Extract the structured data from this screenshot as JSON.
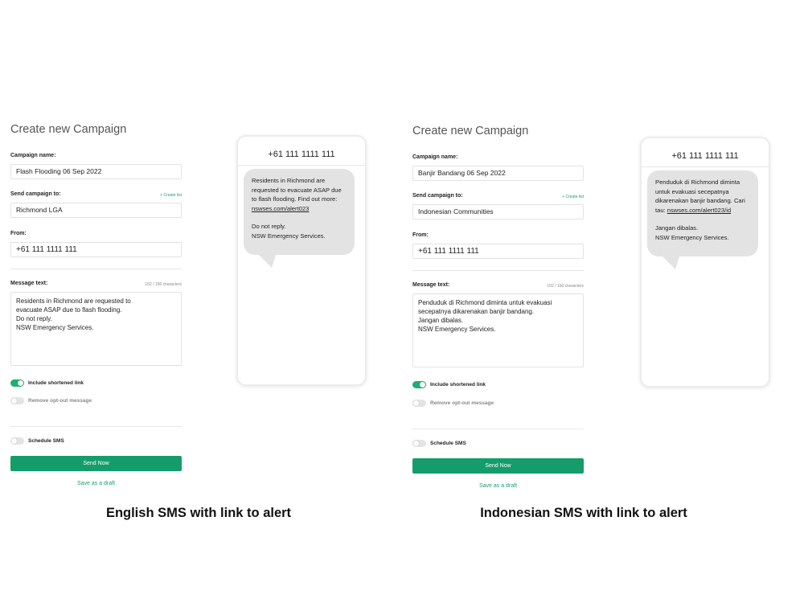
{
  "panels": [
    {
      "form": {
        "title": "Create new Campaign",
        "campaign_name_label": "Campaign name:",
        "campaign_name_value": "Flash Flooding 06 Sep 2022",
        "send_to_label": "Send campaign to:",
        "create_list_link": "+ Create list",
        "send_to_value": "Richmond LGA",
        "from_label": "From:",
        "from_value": "+61 111 1111 111",
        "message_label": "Message text:",
        "char_count": "102 / 160 characters",
        "message_value": "Residents in  Richmond are requested to\nevacuate ASAP due to flash flooding.\nDo not reply.\nNSW Emergency Services.",
        "include_link_label": "Include shortened link",
        "include_link_on": true,
        "opt_out_label": "Remove opt-out message",
        "opt_out_on": false,
        "schedule_label": "Schedule SMS",
        "schedule_on": false,
        "send_button": "Send Now",
        "draft_link": "Save as a draft"
      },
      "phone": {
        "number": "+61 111 1111 111",
        "line1": "Residents in  Richmond are requested to evacuate ASAP due to flash flooding. Find out more: ",
        "link": "nswses.com/alert023",
        "line2": "Do not reply.",
        "line3": "NSW Emergency Services."
      },
      "caption": "English SMS with link to alert"
    },
    {
      "form": {
        "title": "Create new Campaign",
        "campaign_name_label": "Campaign name:",
        "campaign_name_value": "Banjir Bandang 06 Sep 2022",
        "send_to_label": "Send campaign to:",
        "create_list_link": "+ Create list",
        "send_to_value": "Indonesian Communities",
        "from_label": "From:",
        "from_value": "+61 111 1111 111",
        "message_label": "Message text:",
        "char_count": "102 / 160 characters",
        "message_value": "Penduduk di Richmond diminta untuk evakuasi\nsecepatnya dikarenakan banjir bandang.\nJangan dibalas.\nNSW Emergency Services.",
        "include_link_label": "Include shortened link",
        "include_link_on": true,
        "opt_out_label": "Remove opt-out message",
        "opt_out_on": false,
        "schedule_label": "Schedule SMS",
        "schedule_on": false,
        "send_button": "Send Now",
        "draft_link": "Save as a draft"
      },
      "phone": {
        "number": "+61 111 1111 111",
        "line1": "Penduduk di Richmond diminta untuk evakuasi secepatnya dikarenakan banjir bandang. Cari tau: ",
        "link": "nswses.com/alert023/id",
        "line2": "Jangan dibalas.",
        "line3": "NSW Emergency Services."
      },
      "caption": "Indonesian SMS with link to alert"
    }
  ],
  "colors": {
    "accent_green": "#149d6b",
    "bubble_gray": "#e3e3e3"
  }
}
